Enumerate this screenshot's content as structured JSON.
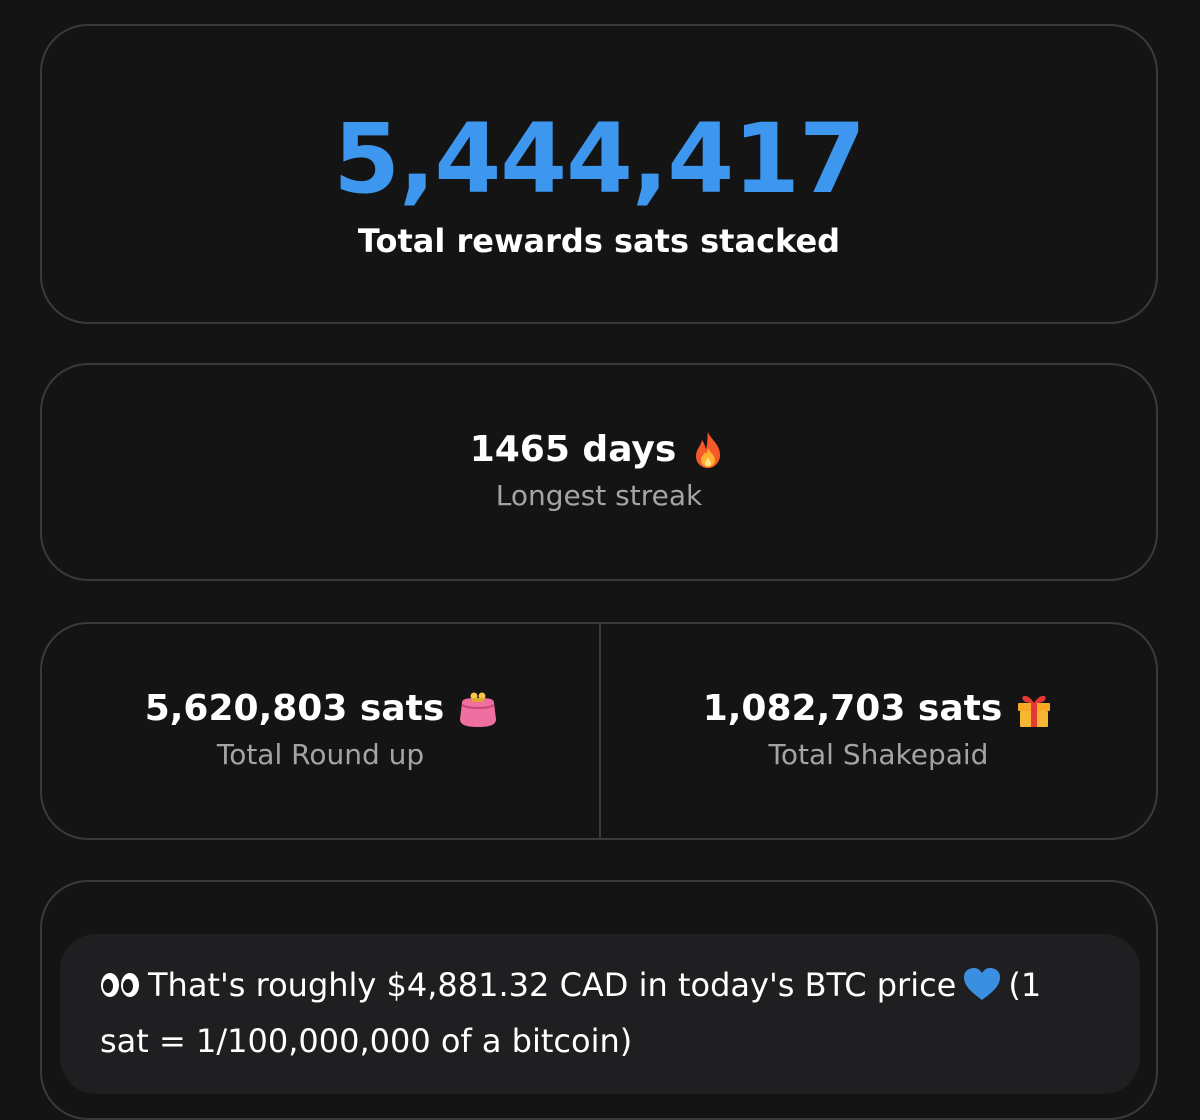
{
  "total": {
    "value": "5,444,417",
    "label": "Total rewards sats stacked"
  },
  "streak": {
    "value": "1465 days",
    "label": "Longest streak",
    "icon": "fire-icon"
  },
  "roundup": {
    "value": "5,620,803 sats",
    "label": "Total Round up",
    "icon": "purse-icon"
  },
  "shakepaid": {
    "value": "1,082,703 sats",
    "label": "Total Shakepaid",
    "icon": "gift-icon"
  },
  "banner": {
    "text_before": "That's roughly $4,881.32 CAD in today's BTC price",
    "text_after": "(1 sat = 1/100,000,000 of a bitcoin)",
    "icons": [
      "eyes-icon",
      "blue-heart-icon"
    ]
  },
  "colors": {
    "accent": "#3e97ee",
    "background": "#141415",
    "border": "#3a3a3c",
    "muted_text": "#a4a4a6"
  }
}
